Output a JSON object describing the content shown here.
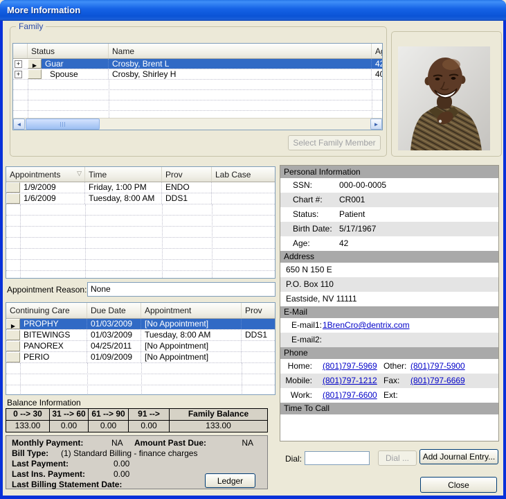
{
  "window": {
    "title": "More Information"
  },
  "icons": {
    "sort_desc": "▽",
    "row_indicator": "▶",
    "expand": "+",
    "scroll_left": "◄",
    "scroll_right": "►"
  },
  "family": {
    "group_label": "Family",
    "columns": {
      "status": "Status",
      "name": "Name",
      "age": "Ag"
    },
    "rows": [
      {
        "status": "Guar",
        "name": "Crosby, Brent L",
        "age": "42"
      },
      {
        "status": "Spouse",
        "name": "Crosby, Shirley H",
        "age": "40"
      }
    ],
    "select_button": "Select Family Member"
  },
  "appointments": {
    "columns": {
      "appointments": "Appointments",
      "time": "Time",
      "prov": "Prov",
      "lab_case": "Lab Case"
    },
    "rows": [
      {
        "date": "1/9/2009",
        "time": "Friday, 1:00 PM",
        "prov": "ENDO",
        "lab_case": ""
      },
      {
        "date": "1/6/2009",
        "time": "Tuesday, 8:00 AM",
        "prov": "DDS1",
        "lab_case": ""
      }
    ],
    "reason_label": "Appointment Reason:",
    "reason_value": "None"
  },
  "continuing_care": {
    "columns": {
      "type": "Continuing Care",
      "due_date": "Due Date",
      "appointment": "Appointment",
      "prov": "Prov"
    },
    "rows": [
      {
        "type": "PROPHY",
        "due_date": "01/03/2009",
        "appointment": "[No Appointment]",
        "prov": ""
      },
      {
        "type": "BITEWINGS",
        "due_date": "01/03/2009",
        "appointment": "Tuesday, 8:00 AM",
        "prov": "DDS1"
      },
      {
        "type": "PANOREX",
        "due_date": "04/25/2011",
        "appointment": "[No Appointment]",
        "prov": ""
      },
      {
        "type": "PERIO",
        "due_date": "01/09/2009",
        "appointment": "[No Appointment]",
        "prov": ""
      }
    ]
  },
  "balance": {
    "section_label": "Balance Information",
    "columns": [
      "0 --> 30",
      "31 --> 60",
      "61 --> 90",
      "91 -->",
      "Family Balance"
    ],
    "values": [
      "133.00",
      "0.00",
      "0.00",
      "0.00",
      "133.00"
    ],
    "monthly_payment_label": "Monthly Payment:",
    "monthly_payment_value": "NA",
    "amount_past_due_label": "Amount Past Due:",
    "amount_past_due_value": "NA",
    "bill_type_label": "Bill Type:",
    "bill_type_value": "(1) Standard Billing - finance charges",
    "last_payment_label": "Last Payment:",
    "last_payment_value": "0.00",
    "last_ins_payment_label": "Last Ins. Payment:",
    "last_ins_payment_value": "0.00",
    "last_billing_label": "Last Billing Statement Date:",
    "ledger_button": "Ledger"
  },
  "personal": {
    "section_label": "Personal Information",
    "rows": [
      {
        "label": "SSN:",
        "value": "000-00-0005"
      },
      {
        "label": "Chart #:",
        "value": "CR001"
      },
      {
        "label": "Status:",
        "value": "Patient"
      },
      {
        "label": "Birth Date:",
        "value": "5/17/1967"
      },
      {
        "label": "Age:",
        "value": "42"
      }
    ]
  },
  "address": {
    "section_label": "Address",
    "lines": [
      "650 N 150 E",
      "P.O. Box 110",
      "Eastside, NV 11111"
    ]
  },
  "email": {
    "section_label": "E-Mail",
    "email1_label": "E-mail1:",
    "email1_value": "1BrenCro@dentrix.com",
    "email2_label": "E-mail2:",
    "email2_value": ""
  },
  "phone": {
    "section_label": "Phone",
    "home_label": "Home:",
    "home_value": "(801)797-5969",
    "other_label": "Other:",
    "other_value": "(801)797-5900",
    "mobile_label": "Mobile:",
    "mobile_value": "(801)797-1212",
    "fax_label": "Fax:",
    "fax_value": "(801)797-6669",
    "work_label": "Work:",
    "work_value": "(801)797-6600",
    "ext_label": "Ext:",
    "ext_value": ""
  },
  "time_to_call": {
    "section_label": "Time To Call",
    "value": ""
  },
  "dial": {
    "label": "Dial:",
    "input_value": "",
    "dial_button": "Dial ...",
    "add_journal_button": "Add Journal Entry...",
    "close_button": "Close"
  },
  "colors": {
    "selection": "#316AC5",
    "titlebar_blue": "#0B53D6",
    "link": "#0000C8",
    "groupbox_label": "#2B4BA8",
    "section_header": "#A9A9A9"
  }
}
